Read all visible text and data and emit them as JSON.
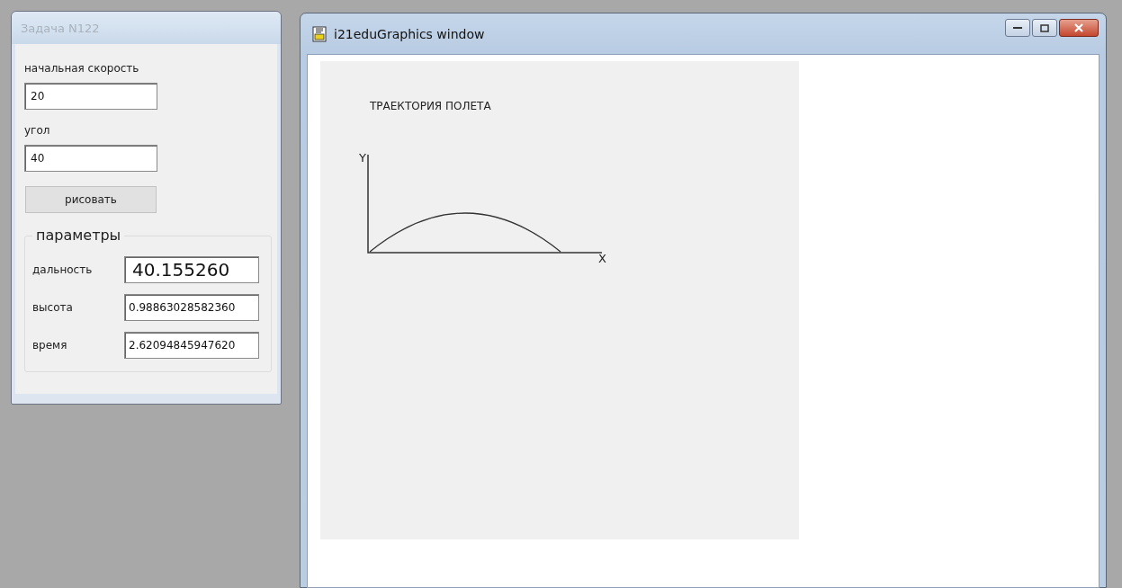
{
  "task_window": {
    "title": "Задача N122",
    "fields": [
      {
        "label": "начальная скорость",
        "value": "20"
      },
      {
        "label": "угол",
        "value": "40"
      }
    ],
    "button": "рисовать",
    "group": {
      "title": "параметры",
      "rows": [
        {
          "label": "дальность",
          "value": "40.155260",
          "kind": "large"
        },
        {
          "label": "высота",
          "value": "0.98863028582360",
          "kind": "normal"
        },
        {
          "label": "время",
          "value": "2.62094845947620",
          "kind": "normal"
        }
      ]
    }
  },
  "graphics_window": {
    "title": "i21eduGraphics window",
    "plot": {
      "title": "ТРАЕКТОРИЯ ПОЛЕТА",
      "y_axis_label": "Y",
      "x_axis_label": "X"
    }
  }
}
